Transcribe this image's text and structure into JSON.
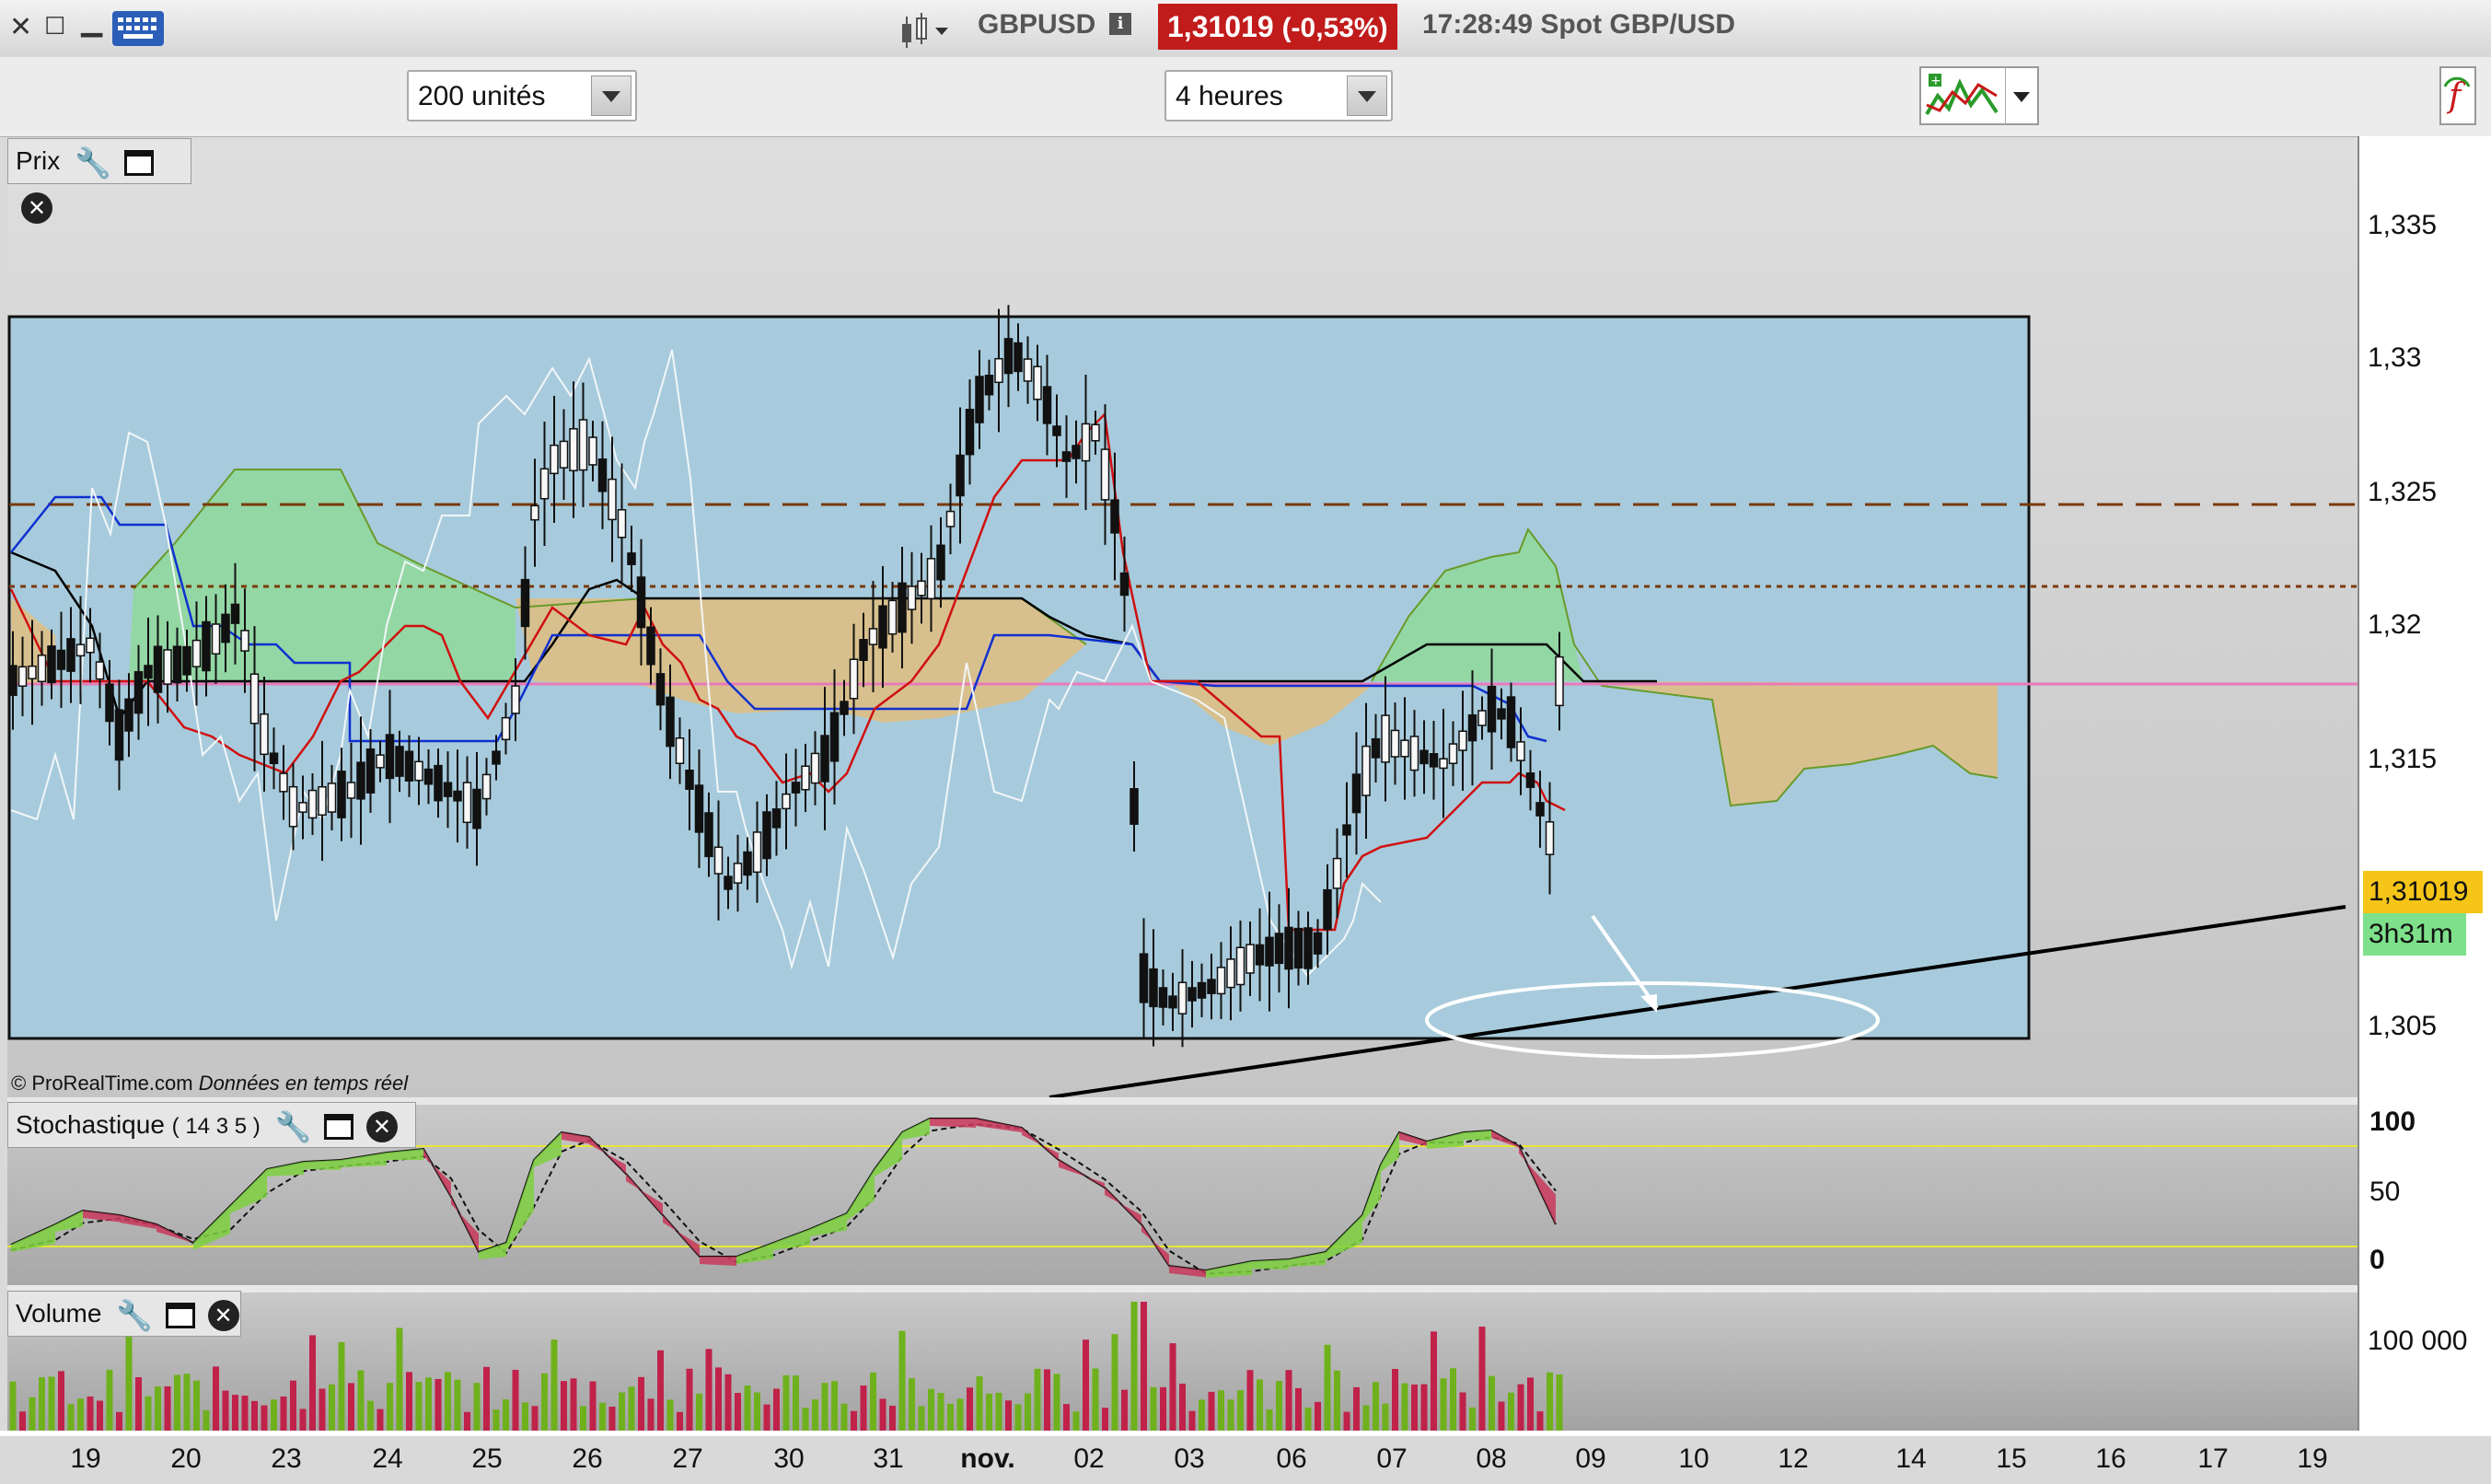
{
  "titlebar": {
    "symbol": "GBPUSD",
    "price": "1,31019",
    "change": "(-0,53%)",
    "time_label": "17:28:49 Spot GBP/USD"
  },
  "toolbar": {
    "units_select": "200 unités",
    "period_select": "4 heures"
  },
  "panels": {
    "price_label": "Prix",
    "stoch_label": "Stochastique",
    "stoch_params": "( 14 3 5 )",
    "volume_label": "Volume"
  },
  "copyright": {
    "brand": "© ProRealTime.com",
    "note": "Données en temps réel"
  },
  "price_axis": {
    "ticks": [
      "1,335",
      "1,33",
      "1,325",
      "1,32",
      "1,315",
      "1,31",
      "1,305"
    ],
    "current_price": "1,31019",
    "countdown": "3h31m"
  },
  "stoch_axis": {
    "ticks": [
      "100",
      "50",
      "0"
    ]
  },
  "volume_axis": {
    "ticks": [
      "100 000"
    ]
  },
  "date_axis": {
    "labels": [
      "19",
      "20",
      "23",
      "24",
      "25",
      "26",
      "27",
      "30",
      "31",
      "nov.",
      "02",
      "03",
      "06",
      "07",
      "08",
      "09",
      "10",
      "12",
      "14",
      "15",
      "16",
      "17",
      "19"
    ]
  },
  "colors": {
    "price_badge": "#c11b1b",
    "current_price_tag": "#f5c518",
    "countdown_tag": "#7ee08a",
    "box_fill": "#a7cbdc",
    "cloud_bull": "#8fd99a",
    "cloud_bear": "#e0be80"
  },
  "chart_data": [
    {
      "type": "candlestick",
      "title": "GBPUSD",
      "ylim": [
        1.302,
        1.338
      ],
      "series": [
        {
          "name": "tenkan",
          "color": "#d01010"
        },
        {
          "name": "kijun",
          "color": "#1030d0"
        },
        {
          "name": "chikou",
          "color": "#ffffff"
        },
        {
          "name": "moving-average",
          "color": "#000000"
        }
      ]
    },
    {
      "type": "area",
      "title": "Stochastique",
      "ylim": [
        0,
        100
      ],
      "levels": [
        80,
        20
      ]
    },
    {
      "type": "bar",
      "title": "Volume",
      "ylim": [
        0,
        100000
      ]
    }
  ]
}
